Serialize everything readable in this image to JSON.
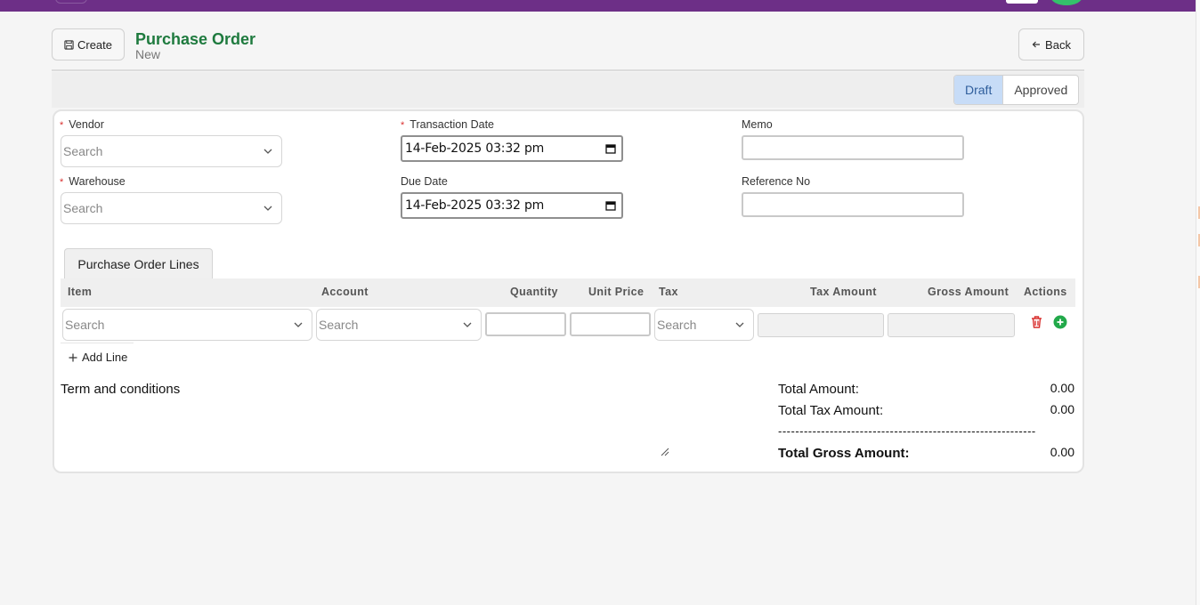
{
  "header": {
    "create_label": "Create",
    "title": "Purchase Order",
    "subtitle": "New",
    "back_label": "Back"
  },
  "status": {
    "options": [
      "Draft",
      "Approved"
    ],
    "active": "Draft"
  },
  "form": {
    "vendor": {
      "label": "Vendor",
      "placeholder": "Search",
      "required_mark": "*"
    },
    "warehouse": {
      "label": "Warehouse",
      "placeholder": "Search",
      "required_mark": "*"
    },
    "transaction_date": {
      "label": "Transaction Date",
      "value": "14-Feb-2025 03:32 pm",
      "required_mark": "*"
    },
    "due_date": {
      "label": "Due Date",
      "value": "14-Feb-2025 03:32 pm"
    },
    "memo": {
      "label": "Memo",
      "value": ""
    },
    "reference_no": {
      "label": "Reference No",
      "value": ""
    }
  },
  "lines": {
    "tab_label": "Purchase Order Lines",
    "columns": [
      "Item",
      "Account",
      "Quantity",
      "Unit Price",
      "Tax",
      "Tax Amount",
      "Gross Amount",
      "Actions"
    ],
    "row": {
      "item_placeholder": "Search",
      "account_placeholder": "Search",
      "tax_placeholder": "Search"
    },
    "add_line_label": "Add Line"
  },
  "terms_label": "Term and conditions",
  "totals": {
    "total_amount_label": "Total Amount:",
    "total_amount": "0.00",
    "total_tax_label": "Total Tax Amount:",
    "total_tax": "0.00",
    "separator": "------------------------------------------------------------",
    "gross_label": "Total Gross Amount:",
    "gross": "0.00"
  },
  "colors": {
    "brand_bar": "#6d2f87",
    "title_green": "#1e7a3e",
    "active_status": "#c7dcf7",
    "delete_red": "#d9302f",
    "add_green": "#22a94a"
  }
}
